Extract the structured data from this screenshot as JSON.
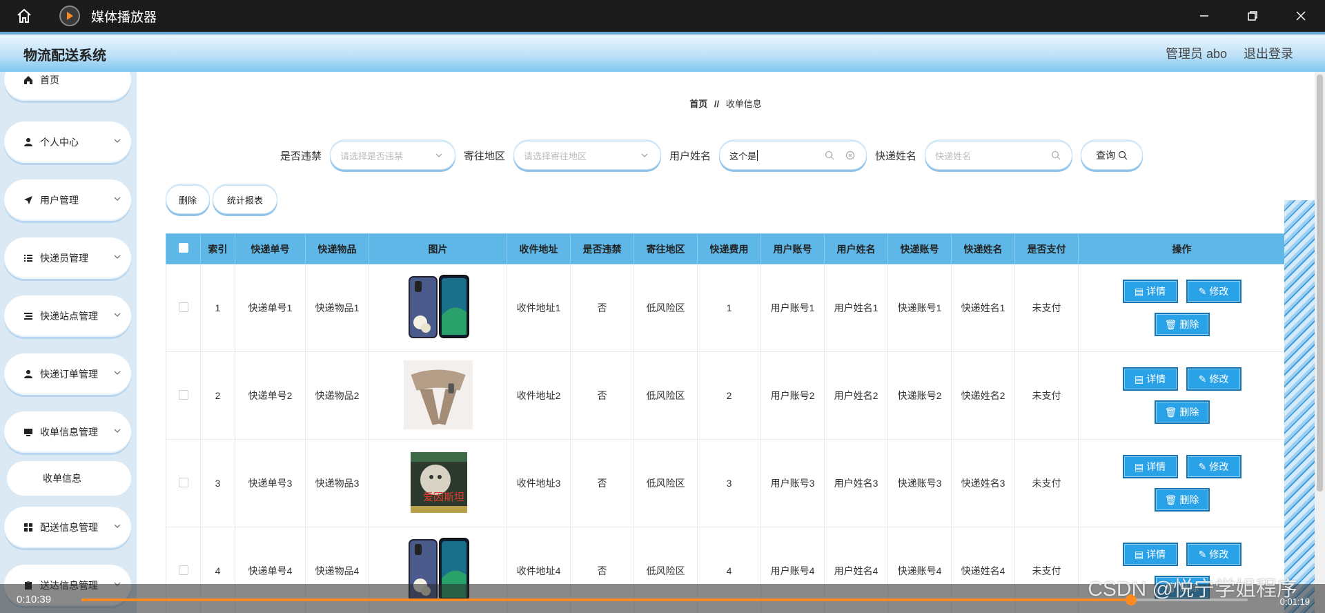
{
  "player": {
    "title": "媒体播放器",
    "current_time": "0:10:39",
    "remaining_time": "0:01:19",
    "progress_fraction": 0.9
  },
  "header": {
    "brand": "物流配送系统",
    "user": "管理员 abo",
    "logout": "退出登录"
  },
  "sidebar": {
    "items": [
      {
        "label": "首页",
        "icon": "home-icon"
      },
      {
        "label": "个人中心",
        "icon": "user-icon"
      },
      {
        "label": "用户管理",
        "icon": "send-icon"
      },
      {
        "label": "快递员管理",
        "icon": "list-icon"
      },
      {
        "label": "快递站点管理",
        "icon": "list-icon"
      },
      {
        "label": "快递订单管理",
        "icon": "user-icon"
      },
      {
        "label": "收单信息管理",
        "icon": "monitor-icon"
      },
      {
        "label": "配送信息管理",
        "icon": "grid-icon"
      },
      {
        "label": "送达信息管理",
        "icon": "clipboard-icon"
      }
    ],
    "sub_item": "收单信息"
  },
  "breadcrumb": {
    "home": "首页",
    "separator": "//",
    "current": "收单信息"
  },
  "filters": {
    "violation_label": "是否违禁",
    "violation_placeholder": "请选择是否违禁",
    "region_label": "寄往地区",
    "region_placeholder": "请选择寄往地区",
    "username_label": "用户姓名",
    "username_value": "这个是",
    "courier_label": "快递姓名",
    "courier_placeholder": "快递姓名",
    "query_button": "查询"
  },
  "actions": {
    "delete": "删除",
    "report": "统计报表"
  },
  "table": {
    "headers": [
      "索引",
      "快递单号",
      "快递物品",
      "图片",
      "收件地址",
      "是否违禁",
      "寄往地区",
      "快递费用",
      "用户账号",
      "用户姓名",
      "快递账号",
      "快递姓名",
      "是否支付",
      "操作"
    ],
    "rows": [
      {
        "index": "1",
        "tracking": "快递单号1",
        "item": "快递物品1",
        "address": "收件地址1",
        "violation": "否",
        "region": "低风险区",
        "fee": "1",
        "account": "用户账号1",
        "username": "用户姓名1",
        "courier_account": "快递账号1",
        "courier_name": "快递姓名1",
        "paid": "未支付",
        "image": "phone"
      },
      {
        "index": "2",
        "tracking": "快递单号2",
        "item": "快递物品2",
        "address": "收件地址2",
        "violation": "否",
        "region": "低风险区",
        "fee": "2",
        "account": "用户账号2",
        "username": "用户姓名2",
        "courier_account": "快递账号2",
        "courier_name": "快递姓名2",
        "paid": "未支付",
        "image": "massager"
      },
      {
        "index": "3",
        "tracking": "快递单号3",
        "item": "快递物品3",
        "address": "收件地址3",
        "violation": "否",
        "region": "低风险区",
        "fee": "3",
        "account": "用户账号3",
        "username": "用户姓名3",
        "courier_account": "快递账号3",
        "courier_name": "快递姓名3",
        "paid": "未支付",
        "image": "book"
      },
      {
        "index": "4",
        "tracking": "快递单号4",
        "item": "快递物品4",
        "address": "收件地址4",
        "violation": "否",
        "region": "低风险区",
        "fee": "4",
        "account": "用户账号4",
        "username": "用户姓名4",
        "courier_account": "快递账号4",
        "courier_name": "快递姓名4",
        "paid": "未支付",
        "image": "phone"
      }
    ],
    "detail_button": "详情",
    "edit_button": "修改",
    "delete_button": "删除"
  },
  "book_cover_text": "爱因斯坦",
  "watermark": "CSDN @悦宁学姐程序"
}
